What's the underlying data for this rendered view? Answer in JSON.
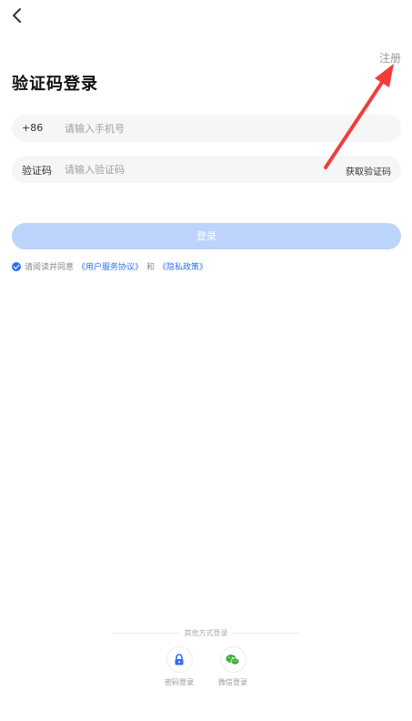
{
  "header": {
    "register_label": "注册",
    "title": "验证码登录"
  },
  "form": {
    "phone_prefix": "+86",
    "phone_placeholder": "请输入手机号",
    "code_label": "验证码",
    "code_placeholder": "请输入验证码",
    "get_code_label": "获取验证码",
    "login_label": "登录"
  },
  "agreement": {
    "prefix": "请阅读并同意",
    "user_agreement": "《用户服务协议》",
    "conjunction": "和",
    "privacy_policy": "《隐私政策》",
    "checked": true
  },
  "other_login": {
    "heading": "其他方式登录",
    "options": [
      {
        "label": "密码登录",
        "icon": "lock-icon"
      },
      {
        "label": "微信登录",
        "icon": "wechat-icon"
      }
    ]
  },
  "colors": {
    "accent": "#2f6ff0",
    "login_button": "#bcd4fb",
    "field_bg": "#f6f6f6",
    "wechat": "#3cb035",
    "annotation_arrow": "#f23c3c"
  }
}
